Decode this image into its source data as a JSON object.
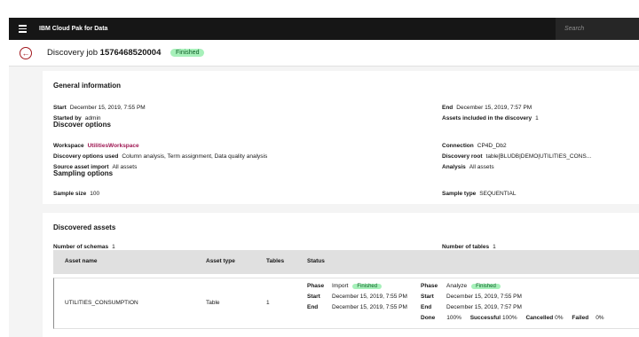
{
  "topbar": {
    "brand_prefix": "IBM",
    "brand_name": "Cloud Pak for Data",
    "search_placeholder": "Search"
  },
  "header": {
    "title_prefix": "Discovery job",
    "job_id": "1576468520004",
    "status": "Finished"
  },
  "general": {
    "heading": "General information",
    "start_label": "Start",
    "start_value": "December 15, 2019, 7:55 PM",
    "end_label": "End",
    "end_value": "December 15, 2019, 7:57 PM",
    "started_by_label": "Started by",
    "started_by_value": "admin",
    "assets_included_label": "Assets included in the discovery",
    "assets_included_value": "1"
  },
  "discover_options": {
    "heading": "Discover options",
    "workspace_label": "Workspace",
    "workspace_value": "UtilitiesWorkspace",
    "connection_label": "Connection",
    "connection_value": "CP4D_Db2",
    "options_used_label": "Discovery options used",
    "options_used_value": "Column analysis, Term assignment, Data quality analysis",
    "root_label": "Discovery root",
    "root_value": "table[BLUDB|DEMO|UTILITIES_CONS...",
    "source_import_label": "Source asset import",
    "source_import_value": "All assets",
    "analysis_label": "Analysis",
    "analysis_value": "All assets"
  },
  "sampling": {
    "heading": "Sampling options",
    "size_label": "Sample size",
    "size_value": "100",
    "type_label": "Sample type",
    "type_value": "SEQUENTIAL"
  },
  "discovered": {
    "heading": "Discovered assets",
    "schemas_label": "Number of schemas",
    "schemas_value": "1",
    "tables_label": "Number of tables",
    "tables_value": "1",
    "columns": [
      "Asset name",
      "Asset type",
      "Tables",
      "Status"
    ],
    "row": {
      "asset_name": "UTILITIES_CONSUMPTION",
      "asset_type": "Table",
      "tables": "1",
      "import_phase_label": "Phase",
      "import_phase_value": "Import",
      "import_status": "Finished",
      "import_start_label": "Start",
      "import_start_value": "December 15, 2019, 7:55 PM",
      "import_end_label": "End",
      "import_end_value": "December 15, 2019, 7:55 PM",
      "analyze_phase_label": "Phase",
      "analyze_phase_value": "Analyze",
      "analyze_status": "Finished",
      "analyze_start_label": "Start",
      "analyze_start_value": "December 15, 2019, 7:55 PM",
      "analyze_end_label": "End",
      "analyze_end_value": "December 15, 2019, 7:57 PM",
      "done_label": "Done",
      "done_value": "100%",
      "successful_label": "Successful",
      "successful_value": "100%",
      "cancelled_label": "Cancelled",
      "cancelled_value": "0%",
      "failed_label": "Failed",
      "failed_value": "0%"
    }
  },
  "colors": {
    "topbar": "#161616",
    "accent": "#a2191f",
    "finished_bg": "#a7f0ba",
    "finished_text": "#0e6027"
  }
}
